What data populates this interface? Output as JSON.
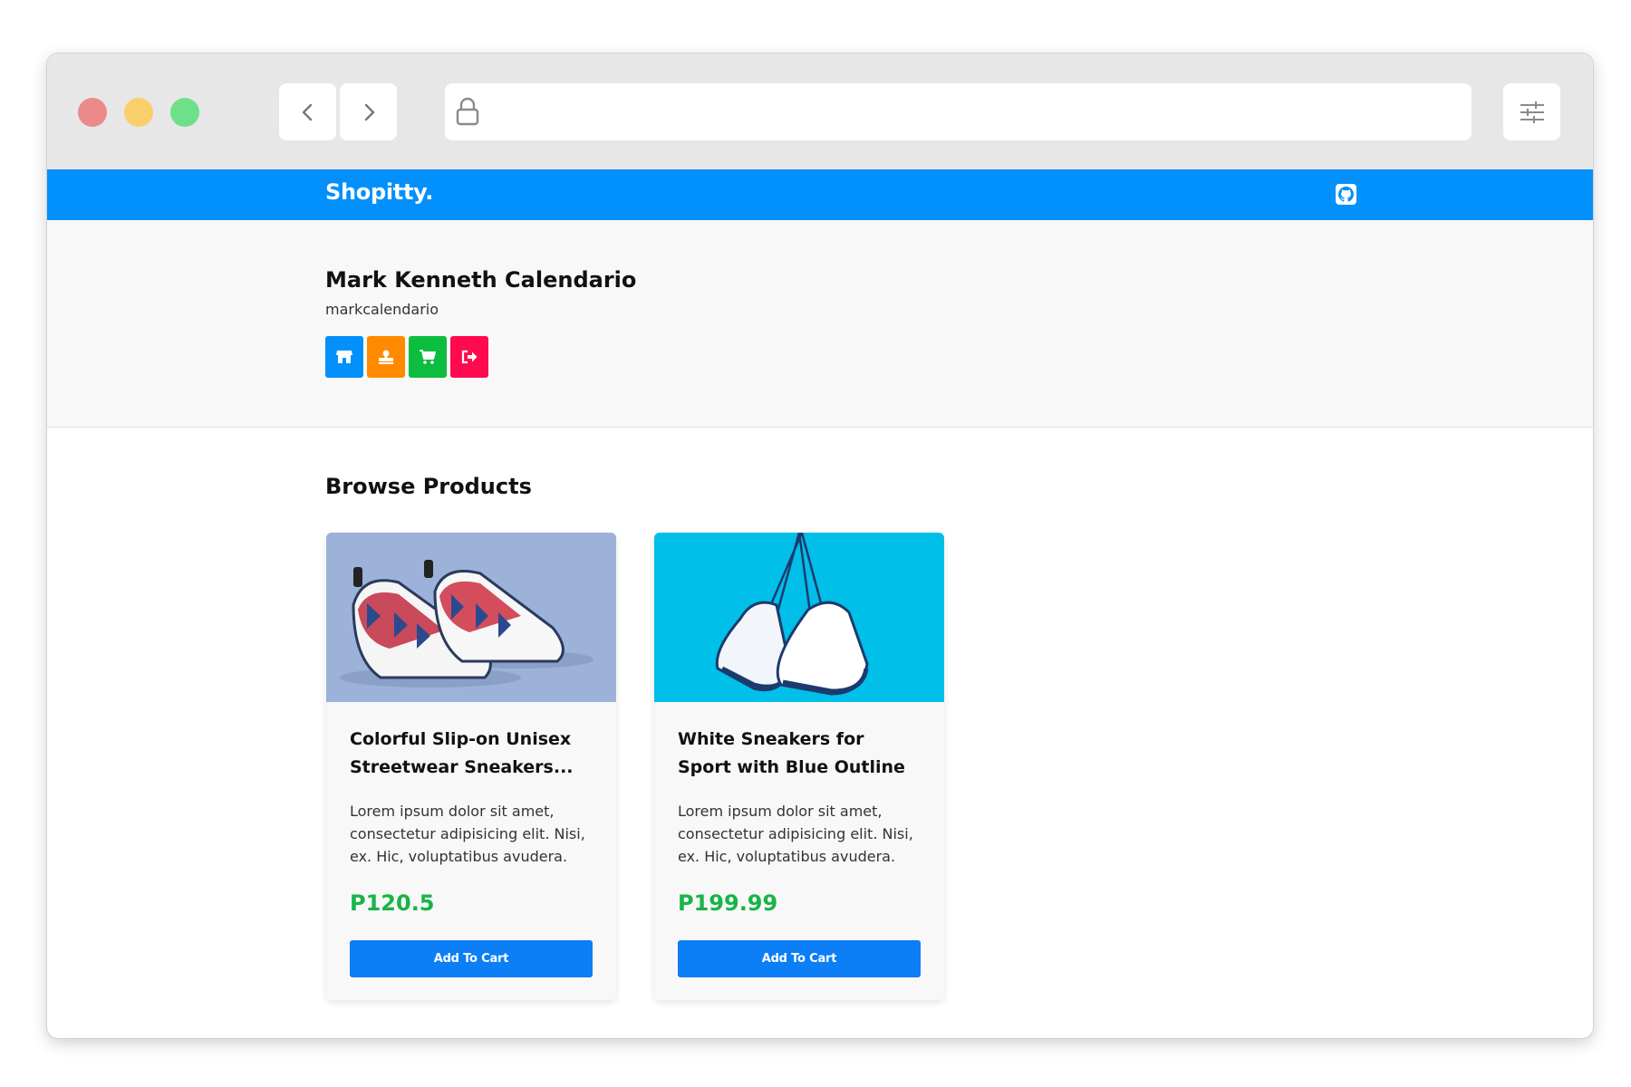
{
  "navbar": {
    "brand": "Shopitty."
  },
  "profile": {
    "name": "Mark Kenneth Calendario",
    "username": "markcalendario",
    "actions": [
      {
        "icon": "store-icon",
        "color": "#0290fc"
      },
      {
        "icon": "stamp-icon",
        "color": "#ff8a00"
      },
      {
        "icon": "cart-icon",
        "color": "#0dbd3f"
      },
      {
        "icon": "logout-icon",
        "color": "#ff0a4f"
      }
    ]
  },
  "main": {
    "section_title": "Browse Products",
    "products": [
      {
        "title": "Colorful Slip-on Unisex Streetwear Sneakers...",
        "description": "Lorem ipsum dolor sit amet, consectetur adipisicing elit. Nisi, ex. Hic, voluptatibus avudera.",
        "price": "P120.5",
        "button_label": "Add To Cart"
      },
      {
        "title": "White Sneakers for Sport with Blue Outline",
        "description": "Lorem ipsum dolor sit amet, consectetur adipisicing elit. Nisi, ex. Hic, voluptatibus avudera.",
        "price": "P199.99",
        "button_label": "Add To Cart"
      }
    ]
  },
  "colors": {
    "navbar": "#0290fc",
    "price": "#18b44a",
    "button": "#0c7ef6"
  }
}
